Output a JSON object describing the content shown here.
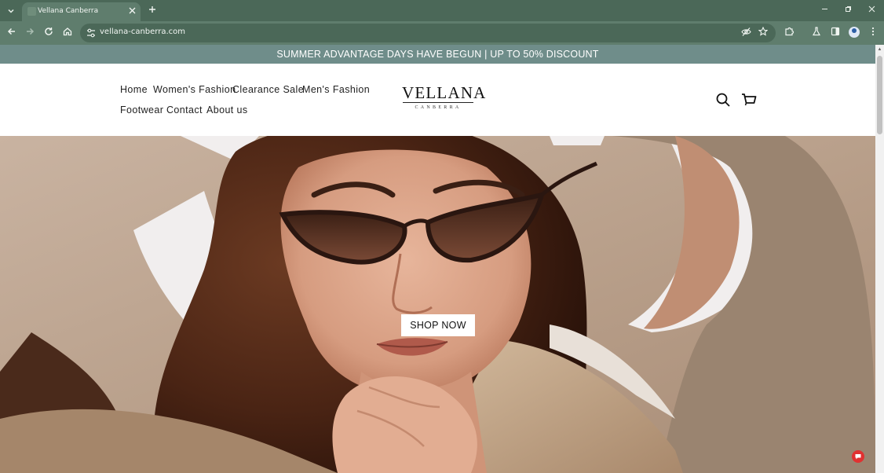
{
  "browser": {
    "tab_title": "Vellana Canberra",
    "url": "vellana-canberra.com"
  },
  "icons": {
    "tab_search": "chevron-down-icon",
    "close_tab": "close-icon",
    "new_tab": "plus-icon",
    "back": "arrow-left-icon",
    "forward": "arrow-right-icon",
    "reload": "reload-icon",
    "home": "home-icon",
    "site_info": "tune-icon",
    "tracking": "eye-off-icon",
    "bookmark": "star-icon",
    "extensions": "puzzle-icon",
    "labs": "flask-icon",
    "side_panel": "side-panel-icon",
    "profile": "profile-icon",
    "menu": "kebab-menu-icon",
    "search": "search-icon",
    "cart": "cart-icon"
  },
  "announcement": "SUMMER ADVANTAGE DAYS HAVE BEGUN | UP TO 50% DISCOUNT",
  "nav": {
    "home": "Home",
    "womens": "Women's Fashion",
    "clearance": "Clearance Sale",
    "mens": "Men's Fashion",
    "footwear": "Footwear",
    "contact": "Contact",
    "about": "About us"
  },
  "logo": {
    "main": "VELLANA",
    "sub": "CANBERRA"
  },
  "hero": {
    "cta": "SHOP NOW"
  },
  "colors": {
    "chrome_dark": "#4b6858",
    "chrome_light": "#5f7d6d",
    "announcement_bg": "#6f8d8a",
    "hero_bg": "#c2ad9a"
  }
}
